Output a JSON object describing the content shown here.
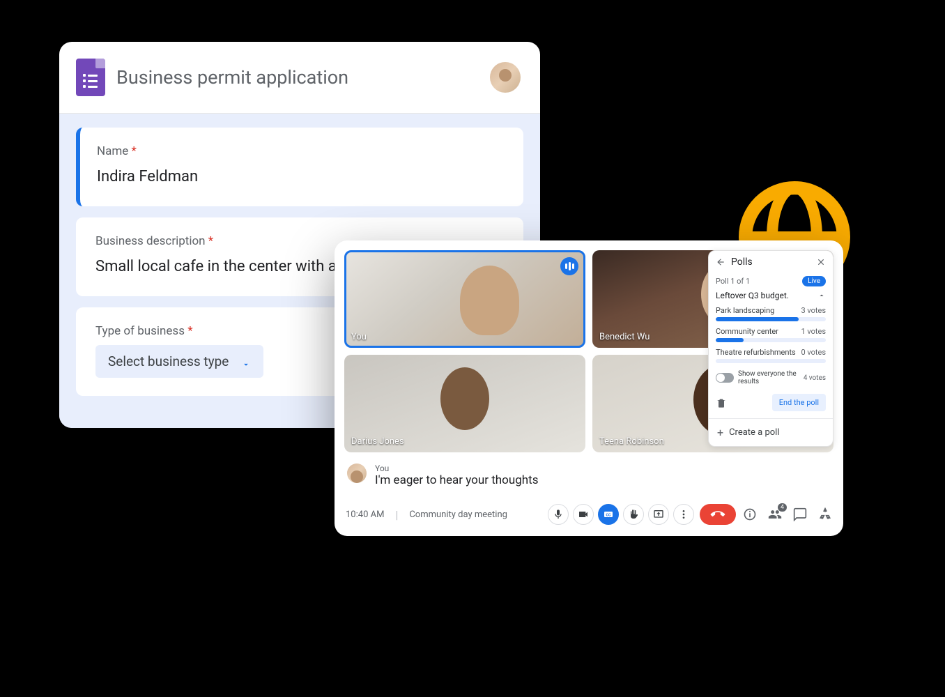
{
  "forms": {
    "title": "Business permit application",
    "q1": {
      "label": "Name",
      "value": "Indira Feldman"
    },
    "q2": {
      "label": "Business description",
      "value": "Small local cafe in the center with an onsite bakery."
    },
    "q3": {
      "label": "Type of business",
      "select_value": "Select business type"
    },
    "required_mark": "*"
  },
  "meet": {
    "tiles": {
      "t1": "You",
      "t2": "Benedict Wu",
      "t3": "Darius Jones",
      "t4": "Teena Robinson"
    },
    "caption": {
      "who": "You",
      "line": "I'm eager to hear your thoughts"
    },
    "time": "10:40 AM",
    "meeting_name": "Community day meeting",
    "participant_count": "4",
    "cc_label": "CC"
  },
  "polls": {
    "title": "Polls",
    "count": "Poll 1 of 1",
    "live": "Live",
    "question": "Leftover Q3 budget.",
    "options": [
      {
        "label": "Park landscaping",
        "votes_label": "3 votes",
        "pct": 75
      },
      {
        "label": "Community center",
        "votes_label": "1 votes",
        "pct": 25
      },
      {
        "label": "Theatre refurbishments",
        "votes_label": "0 votes",
        "pct": 0
      }
    ],
    "toggle_label": "Show everyone the results",
    "total_votes": "4 votes",
    "end_label": "End the poll",
    "create_label": "Create a poll"
  }
}
